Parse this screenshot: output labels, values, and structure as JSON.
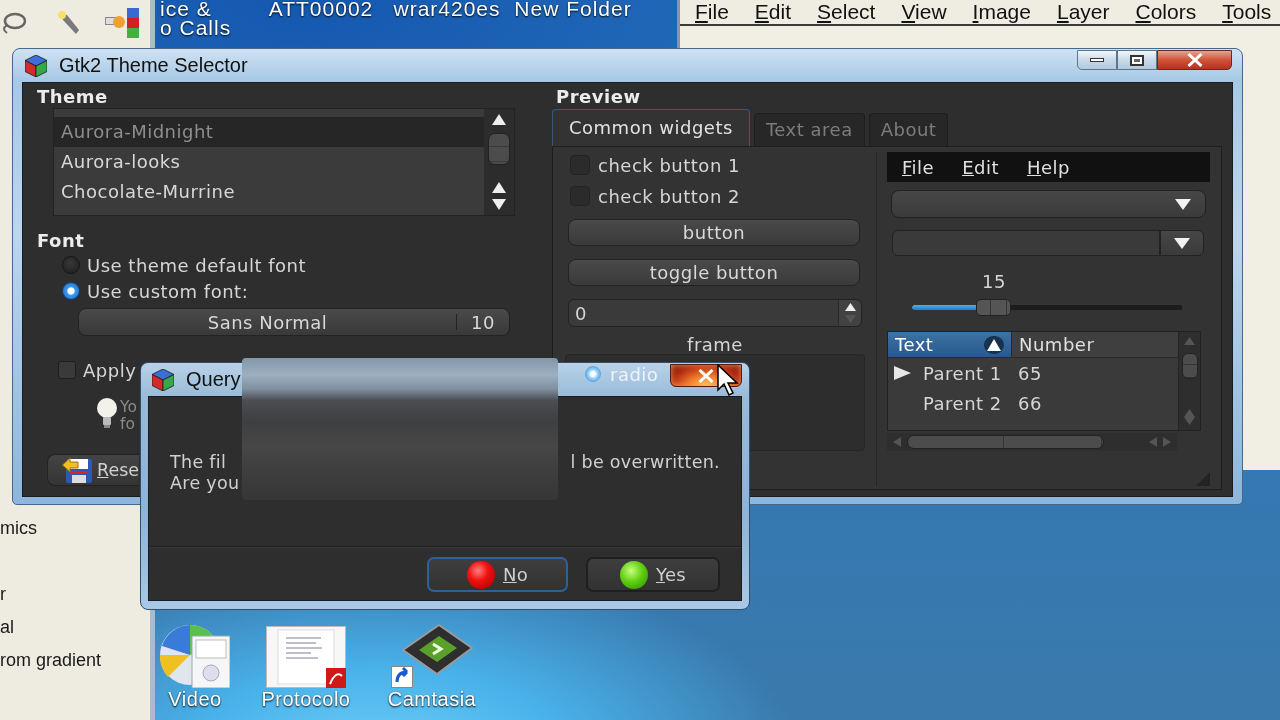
{
  "desktop": {
    "top_icons": [
      {
        "label": "ice &\no Calls"
      },
      {
        "label": "ATT00002"
      },
      {
        "label": "wrar420es"
      },
      {
        "label": "New Folder"
      }
    ],
    "bottom_icons": [
      {
        "kind": "media",
        "label": "Video"
      },
      {
        "kind": "pdf",
        "label": "Protocolo"
      },
      {
        "kind": "shortcut",
        "label": "Camtasia"
      }
    ]
  },
  "gimp_panel": {
    "items": [
      "mics",
      "r",
      "al",
      "rom gradient"
    ]
  },
  "gimp_window": {
    "menu": [
      "File",
      "Edit",
      "Select",
      "View",
      "Image",
      "Layer",
      "Colors",
      "Tools"
    ]
  },
  "theme_selector": {
    "title": "Gtk2 Theme Selector",
    "theme_heading": "Theme",
    "themes": [
      {
        "name": "Aurora-Midnight",
        "selected": true
      },
      {
        "name": "Aurora-looks",
        "selected": false
      },
      {
        "name": "Chocolate-Murrine",
        "selected": false
      }
    ],
    "font_heading": "Font",
    "font_options": [
      {
        "label": "Use theme default font",
        "selected": false
      },
      {
        "label": "Use custom font:",
        "selected": true
      }
    ],
    "font_button": {
      "name": "Sans Normal",
      "size": "10"
    },
    "apply_all": {
      "label": "Apply",
      "checked": false
    },
    "hint": "Yo\nfo",
    "reset_button": "Rese",
    "preview": {
      "heading": "Preview",
      "tabs": [
        {
          "label": "Common widgets",
          "selected": true
        },
        {
          "label": "Text area",
          "selected": false
        },
        {
          "label": "About",
          "selected": false
        }
      ],
      "checks": [
        {
          "label": "check button 1",
          "checked": false
        },
        {
          "label": "check button 2",
          "checked": false
        }
      ],
      "button": "button",
      "toggle_button": "toggle button",
      "spin_value": "0",
      "frame": {
        "title": "frame",
        "radio": {
          "label": "radio",
          "selected": true
        }
      },
      "menu": [
        "File",
        "Edit",
        "Help"
      ],
      "slider": {
        "value": "15",
        "level": 0.3
      },
      "tree": {
        "columns": [
          {
            "label": "Text",
            "sorted": true
          },
          {
            "label": "Number",
            "sorted": false
          }
        ],
        "rows": [
          {
            "text": "Parent 1",
            "number": "65",
            "has_children": true
          },
          {
            "text": "Parent 2",
            "number": "66",
            "has_children": false
          }
        ]
      }
    }
  },
  "query_dialog": {
    "title": "Query",
    "message": [
      {
        "start": "The fil",
        "end": "l be overwritten."
      },
      {
        "start": "Are you"
      }
    ],
    "buttons": [
      {
        "kind": "no",
        "label": "No",
        "focused": true
      },
      {
        "kind": "yes",
        "label": "Yes",
        "focused": false
      }
    ]
  }
}
